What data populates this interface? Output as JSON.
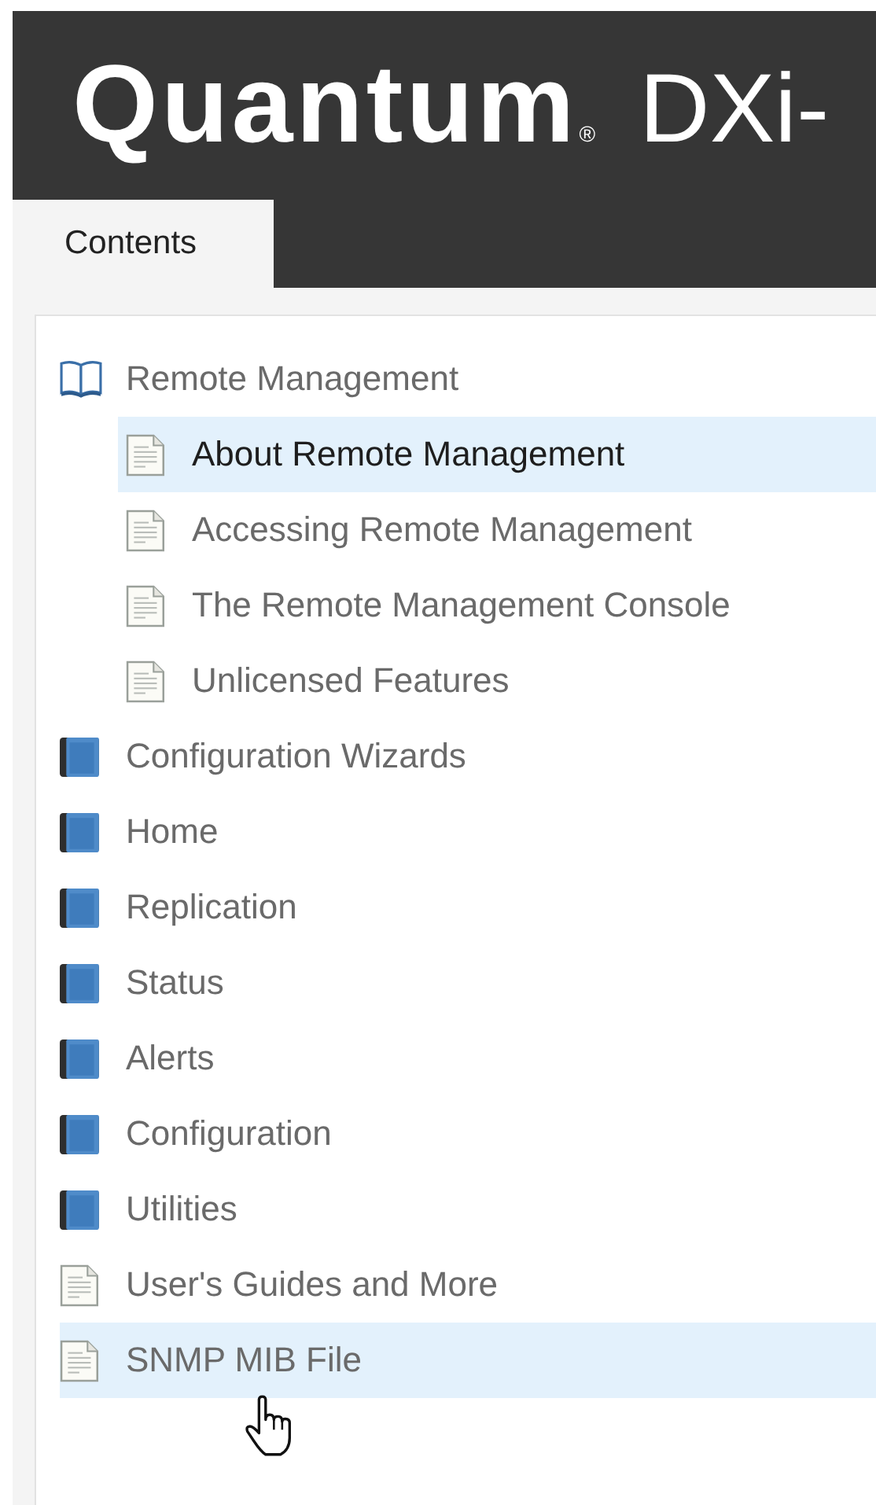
{
  "header": {
    "logo": "Quantum",
    "logo_mark": "®",
    "product": "DXi-"
  },
  "tabs": [
    {
      "label": "Contents",
      "selected": true
    }
  ],
  "toc": [
    {
      "label": "Remote Management",
      "kind": "open-book",
      "selected": false,
      "hovered": false,
      "children": [
        {
          "label": "About Remote Management",
          "kind": "page",
          "selected": true,
          "hovered": false
        },
        {
          "label": "Accessing Remote Management",
          "kind": "page",
          "selected": false,
          "hovered": false
        },
        {
          "label": "The Remote Management Console",
          "kind": "page",
          "selected": false,
          "hovered": false
        },
        {
          "label": "Unlicensed Features",
          "kind": "page",
          "selected": false,
          "hovered": false
        }
      ]
    },
    {
      "label": "Configuration Wizards",
      "kind": "book",
      "selected": false,
      "hovered": false
    },
    {
      "label": "Home",
      "kind": "book",
      "selected": false,
      "hovered": false
    },
    {
      "label": "Replication",
      "kind": "book",
      "selected": false,
      "hovered": false
    },
    {
      "label": "Status",
      "kind": "book",
      "selected": false,
      "hovered": false
    },
    {
      "label": "Alerts",
      "kind": "book",
      "selected": false,
      "hovered": false
    },
    {
      "label": "Configuration",
      "kind": "book",
      "selected": false,
      "hovered": false
    },
    {
      "label": "Utilities",
      "kind": "book",
      "selected": false,
      "hovered": false
    },
    {
      "label": "User's Guides and More",
      "kind": "page",
      "selected": false,
      "hovered": false
    },
    {
      "label": "SNMP MIB File",
      "kind": "page",
      "selected": false,
      "hovered": true
    }
  ]
}
